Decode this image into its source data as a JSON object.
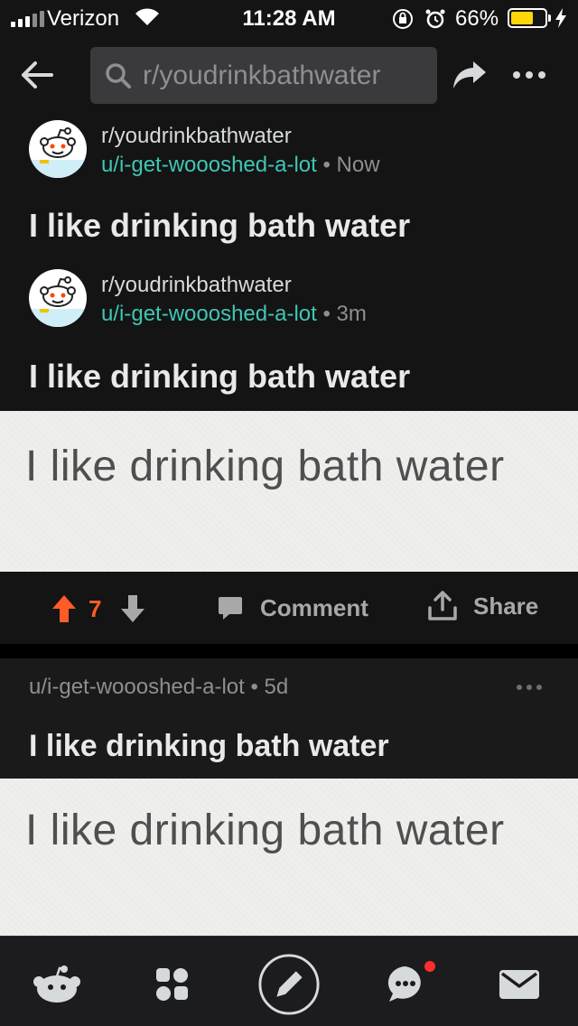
{
  "status_bar": {
    "carrier": "Verizon",
    "time": "11:28 AM",
    "battery_percent": "66%",
    "battery_level": 0.66,
    "battery_color": "#ffd60a"
  },
  "header": {
    "search_text": "r/youdrinkbathwater",
    "icons": [
      "back-arrow-icon",
      "search-icon",
      "share-arrow-icon",
      "more-dots-icon"
    ]
  },
  "crosspost": {
    "subreddit": "r/youdrinkbathwater",
    "user": "u/i-get-woooshed-a-lot",
    "separator": "•",
    "age": "Now",
    "title": "I like drinking bath water"
  },
  "original_post": {
    "subreddit": "r/youdrinkbathwater",
    "user": "u/i-get-woooshed-a-lot",
    "separator": "•",
    "age": "3m",
    "title": "I like drinking bath water",
    "image_text": "I like drinking bath water"
  },
  "actions": {
    "score": "7",
    "comment_label": "Comment",
    "share_label": "Share",
    "upvote_color": "#ff5c28"
  },
  "feed_post": {
    "user": "u/i-get-woooshed-a-lot",
    "separator": "•",
    "age": "5d",
    "title": "I like drinking bath water",
    "image_text": "I like drinking bath water"
  },
  "tab_bar": {
    "tabs": [
      "home-icon",
      "communities-icon",
      "post-icon",
      "chat-icon",
      "inbox-icon"
    ],
    "chat_has_notification": true
  },
  "colors": {
    "background": "#141414",
    "username_link": "#3fc6b5",
    "notification": "#ff2d2d"
  }
}
